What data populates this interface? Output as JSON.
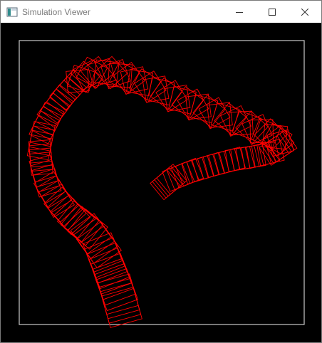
{
  "window": {
    "title": "Simulation Viewer",
    "controls": {
      "minimize_icon": "minimize-icon",
      "maximize_icon": "maximize-icon",
      "close_icon": "close-icon"
    }
  },
  "viewer": {
    "background_color": "#000000",
    "frame_color": "#c8c8c8",
    "shape_color": "#ff0000"
  }
}
